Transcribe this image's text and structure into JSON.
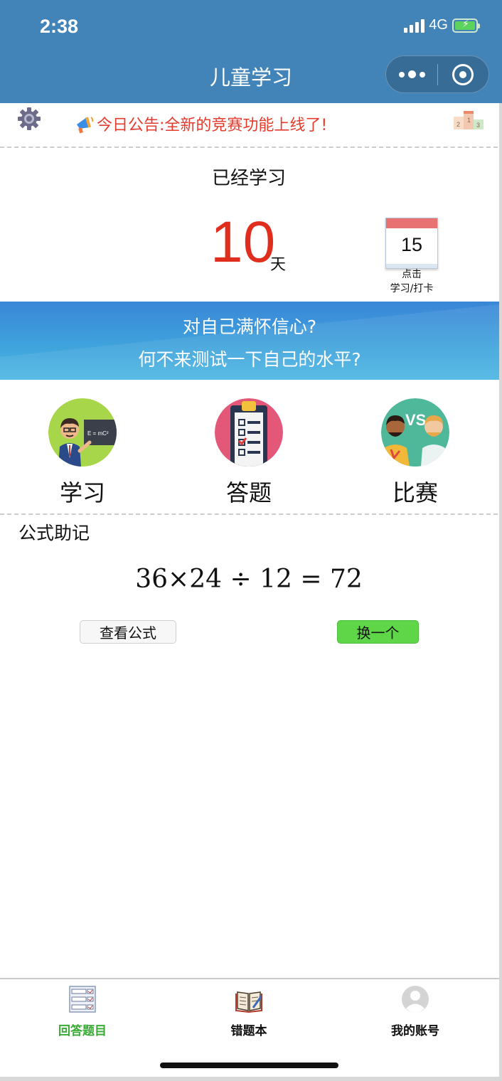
{
  "status_bar": {
    "time": "2:38",
    "network": "4G"
  },
  "nav": {
    "title": "儿童学习"
  },
  "announcement": {
    "text": "今日公告:全新的竞赛功能上线了!"
  },
  "study": {
    "label": "已经学习",
    "days": "10",
    "unit": "天",
    "calendar_day": "15",
    "checkin_line1": "点击",
    "checkin_line2": "学习/打卡"
  },
  "banner": {
    "line1": "对自己满怀信心?",
    "line2": "何不来测试一下自己的水平?"
  },
  "features": [
    {
      "label": "学习",
      "icon": "teacher-icon"
    },
    {
      "label": "答题",
      "icon": "clipboard-icon"
    },
    {
      "label": "比赛",
      "icon": "versus-icon"
    }
  ],
  "formula": {
    "title": "公式助记",
    "expression": "36×24 ÷ 12 = 72",
    "view_button": "查看公式",
    "next_button": "换一个"
  },
  "tabbar": {
    "items": [
      {
        "label": "回答题目",
        "icon": "question-list-icon",
        "active": true,
        "color": "#3aaa35"
      },
      {
        "label": "错题本",
        "icon": "book-icon",
        "active": false,
        "color": "#111111"
      },
      {
        "label": "我的账号",
        "icon": "user-avatar-icon",
        "active": false,
        "color": "#111111"
      }
    ]
  },
  "colors": {
    "header": "#4384b8",
    "announcement": "#e53b2c",
    "days": "#e02e1e",
    "accent_green": "#5fd647"
  }
}
